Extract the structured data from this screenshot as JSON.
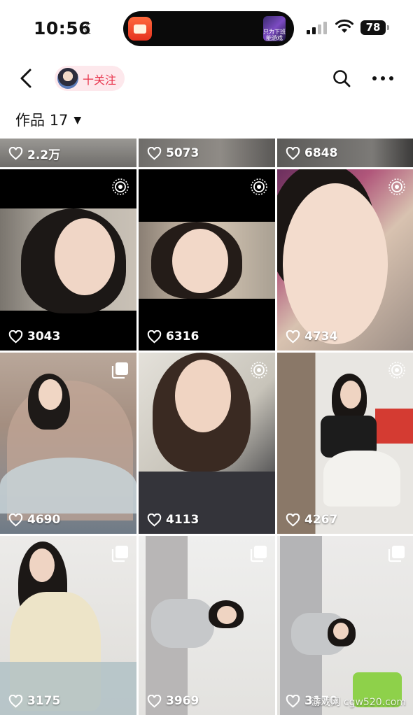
{
  "status_bar": {
    "time": "10:56",
    "battery": "78",
    "island_thumb_text": "只为下班 能游戏"
  },
  "profile": {
    "follow_label": "十关注"
  },
  "works": {
    "label": "作品",
    "count": "17"
  },
  "posts": [
    {
      "likes": "2.2万",
      "badge": "none"
    },
    {
      "likes": "5073",
      "badge": "none"
    },
    {
      "likes": "6848",
      "badge": "none"
    },
    {
      "likes": "3043",
      "badge": "live"
    },
    {
      "likes": "6316",
      "badge": "live"
    },
    {
      "likes": "4734",
      "badge": "live"
    },
    {
      "likes": "4690",
      "badge": "gallery"
    },
    {
      "likes": "4113",
      "badge": "live"
    },
    {
      "likes": "4267",
      "badge": "live"
    },
    {
      "likes": "3175",
      "badge": "gallery"
    },
    {
      "likes": "3969",
      "badge": "gallery"
    },
    {
      "likes": "3170",
      "badge": "gallery"
    }
  ],
  "watermark": "游戏网 cgw520.com",
  "colors": {
    "accent": "#e8334b",
    "pill_bg": "#fde8ec",
    "background": "#ffffff"
  },
  "icons": [
    "moon-icon",
    "signal-icon",
    "wifi-icon",
    "back-icon",
    "search-icon",
    "more-icon",
    "heart-icon",
    "live-photo-icon",
    "gallery-icon"
  ]
}
